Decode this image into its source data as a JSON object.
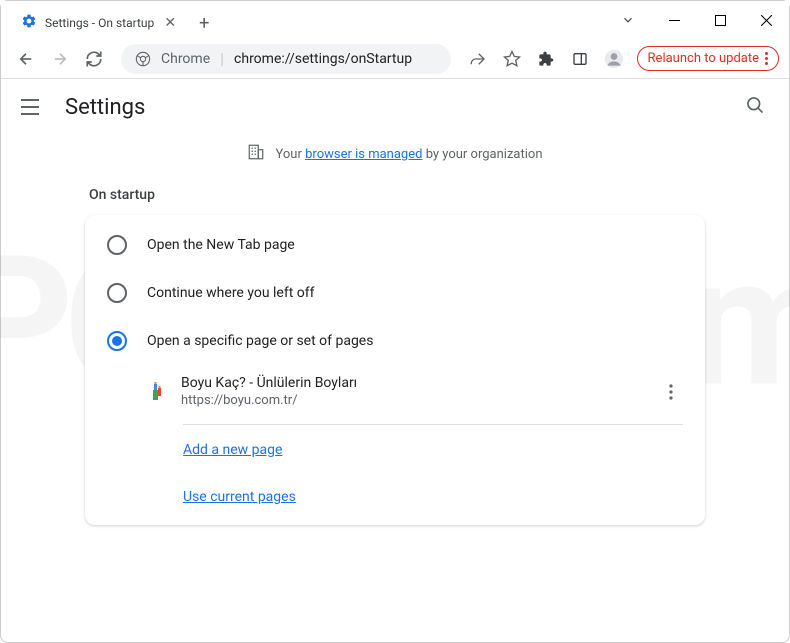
{
  "tab": {
    "title": "Settings - On startup"
  },
  "omnibox": {
    "prefix": "Chrome",
    "url": "chrome://settings/onStartup"
  },
  "relaunch": "Relaunch to update",
  "header": {
    "title": "Settings"
  },
  "managed": {
    "pre": "Your",
    "link": "browser is managed",
    "post": "by your organization"
  },
  "section": {
    "title": "On startup"
  },
  "options": {
    "newtab": "Open the New Tab page",
    "continue": "Continue where you left off",
    "specific": "Open a specific page or set of pages"
  },
  "page": {
    "title": "Boyu Kaç? - Ünlülerin Boyları",
    "url": "https://boyu.com.tr/"
  },
  "links": {
    "add": "Add a new page",
    "current": "Use current pages"
  }
}
